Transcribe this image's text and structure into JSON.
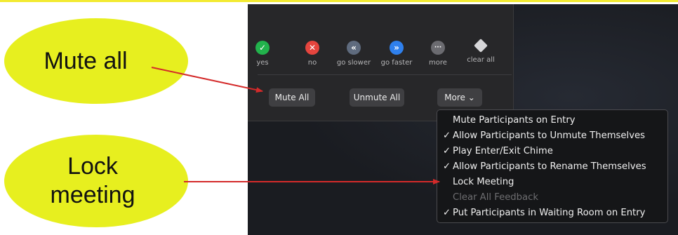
{
  "callouts": {
    "mute_all": "Mute all",
    "lock_meeting": "Lock\nmeeting"
  },
  "reactions": [
    {
      "label": "yes",
      "glyph": "✓",
      "color": "#22b24c",
      "icon": "check-icon"
    },
    {
      "label": "no",
      "glyph": "✕",
      "color": "#e5453e",
      "icon": "x-icon"
    },
    {
      "label": "go slower",
      "glyph": "«",
      "color": "#5f6b7e",
      "icon": "rewind-icon"
    },
    {
      "label": "go faster",
      "glyph": "»",
      "color": "#2f80ed",
      "icon": "fast-forward-icon"
    },
    {
      "label": "more",
      "glyph": "···",
      "color": "#6b6b70",
      "icon": "more-icon"
    },
    {
      "label": "clear all",
      "glyph": "",
      "color": "#d7d7d9",
      "icon": "eraser-icon"
    }
  ],
  "buttons": {
    "mute_all": "Mute All",
    "unmute_all": "Unmute All",
    "more": "More ⌄"
  },
  "menu": {
    "items": [
      {
        "label": "Mute Participants on Entry",
        "checked": ""
      },
      {
        "label": "Allow Participants to Unmute Themselves",
        "checked": "✓"
      },
      {
        "label": "Play Enter/Exit Chime",
        "checked": "✓"
      },
      {
        "label": "Allow Participants to Rename Themselves",
        "checked": "✓"
      },
      {
        "label": "Lock Meeting",
        "checked": ""
      },
      {
        "label": "Clear All Feedback",
        "checked": ""
      },
      {
        "label": "Put Participants in Waiting Room on Entry",
        "checked": "✓"
      }
    ]
  },
  "colors": {
    "callout_fill": "#e7ef1f",
    "arrow": "#d42a2a",
    "panel_bg": "#272729"
  }
}
